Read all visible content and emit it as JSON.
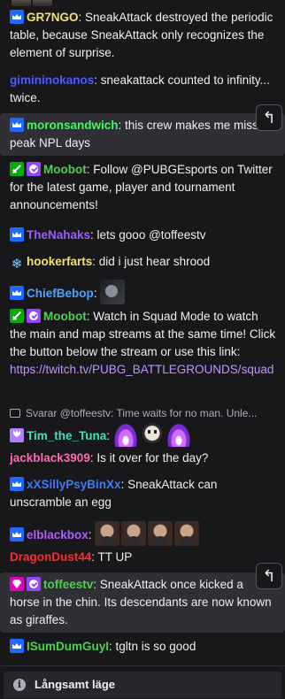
{
  "colors": {
    "background": "#18181b",
    "highlight": "#2f2f35",
    "text": "#efeff1",
    "link": "#bf94ff"
  },
  "messages": [
    {
      "user": "GR7NGO",
      "color": "#f5e06b",
      "badges": [
        "prime"
      ],
      "text": ": SneakAttack destroyed the periodic table, because SneakAttack only recognizes the element of surprise."
    },
    {
      "user": "gimininokanos",
      "color": "#4a5bff",
      "badges": [],
      "text": ": sneakattack counted to infinity... twice."
    },
    {
      "user": "moronsandwich",
      "color": "#33ff58",
      "badges": [
        "prime"
      ],
      "text": ": this crew makes me miss peak NPL days"
    },
    {
      "user": "Moobot",
      "color": "#4fd04f",
      "badges": [
        "mod",
        "verified"
      ],
      "text": ": Follow @PUBGEsports on Twitter for the latest game, player and tournament announcements!"
    },
    {
      "user": "TheNahaks",
      "color": "#9b5cff",
      "badges": [
        "prime"
      ],
      "text": ": lets gooo @toffeestv"
    },
    {
      "user": "hookerfarts",
      "color": "#f5e06b",
      "badges": [
        "snowflake"
      ],
      "text": ": did i just hear shrood"
    },
    {
      "user": "ChiefBebop",
      "color": "#4aa3ff",
      "badges": [
        "prime"
      ],
      "text": ":",
      "emotes": [
        "dark-emote"
      ]
    },
    {
      "user": "Moobot",
      "color": "#4fd04f",
      "badges": [
        "mod",
        "verified"
      ],
      "text": ": Watch in Squad Mode to watch the main and map streams at the same time! Click the button below the stream or use this link: ",
      "link": "https://twitch.tv/PUBG_BATTLEGROUNDS/squad"
    },
    {
      "user": "Tim_the_Tuna",
      "color": "#40e0b8",
      "badges": [
        "tulip"
      ],
      "text": ":",
      "emotes": [
        "purple-fire-emote",
        "skull-emote",
        "purple-fire-emote"
      ]
    },
    {
      "user": "jackblack3909",
      "color": "#ff69b4",
      "badges": [],
      "text": ": Is it over for the day?"
    },
    {
      "user": "xXSillyPsyBinXx",
      "color": "#3a7bff",
      "badges": [
        "prime"
      ],
      "text": ": SneakAttack can unscramble an egg"
    },
    {
      "user": "elblackbox",
      "color": "#b05cff",
      "badges": [
        "prime"
      ],
      "text": ":",
      "emotes": [
        "face-emote",
        "face-emote",
        "face-emote",
        "face-emote"
      ]
    },
    {
      "user": "DragonDust44",
      "color": "#ff2a2a",
      "badges": [],
      "text": ": TT UP"
    },
    {
      "user": "toffeestv",
      "color": "#4fd04f",
      "badges": [
        "vip",
        "verified"
      ],
      "text": ": SneakAttack once kicked a horse in the chin. Its descendants are now known as giraffes."
    },
    {
      "user": "ISumDumGuyI",
      "color": "#4fd04f",
      "badges": [
        "prime"
      ],
      "text": ": tgltn is so good"
    }
  ],
  "reply_context": "Svarar @toffeestv: Time waits for no man. Unle...",
  "reply_button_icon": "reply-arrow-icon",
  "slow_mode_label": "Långsamt läge",
  "slow_mode_icon": "info-icon"
}
